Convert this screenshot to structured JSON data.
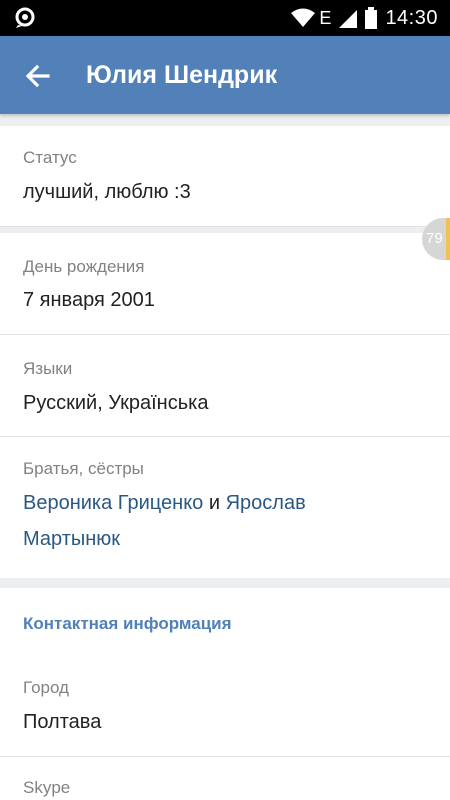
{
  "status_bar": {
    "time": "14:30",
    "network_letter": "E"
  },
  "header": {
    "title": "Юлия Шендрик"
  },
  "profile": {
    "status": {
      "label": "Статус",
      "value": "лучший, люблю :3"
    },
    "birthday": {
      "label": "День рождения",
      "value": "7 января 2001"
    },
    "languages": {
      "label": "Языки",
      "value": "Русский, Українська"
    },
    "siblings": {
      "label": "Братья, сёстры",
      "first": "Вероника Гриценко",
      "conjunction": "и",
      "second_part1": "Ярослав",
      "second_part2": "Мартынюк"
    }
  },
  "contacts": {
    "heading": "Контактная информация",
    "city": {
      "label": "Город",
      "value": "Полтава"
    },
    "skype": {
      "label": "Skype"
    }
  },
  "side_badge": {
    "count": "79",
    "accent_color": "#f3c24e"
  },
  "colors": {
    "header": "#5181b8",
    "link": "#2a5885",
    "label": "#828282"
  }
}
